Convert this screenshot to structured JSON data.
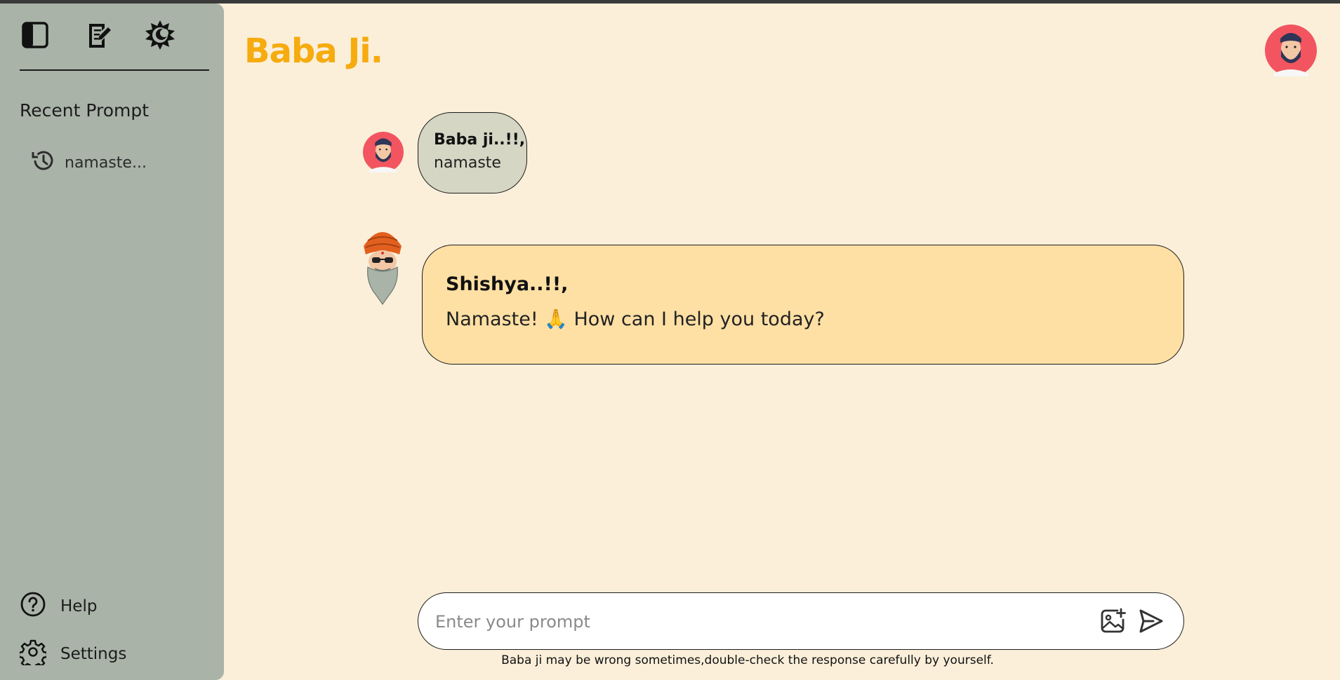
{
  "app": {
    "brand": "Baba Ji."
  },
  "sidebar": {
    "icons": [
      "sidebar-toggle-icon",
      "new-chat-icon",
      "theme-toggle-icon"
    ],
    "recent_title": "Recent Prompt",
    "recent_items": [
      {
        "label": "namaste...",
        "icon": "history-icon"
      }
    ],
    "help_label": "Help",
    "settings_label": "Settings"
  },
  "chat": {
    "messages": [
      {
        "role": "user",
        "sender": "Baba ji..!!,",
        "text": "namaste"
      },
      {
        "role": "bot",
        "sender": "Shishya..!!,",
        "text": "Namaste! 🙏 How can I help you today?"
      }
    ]
  },
  "input": {
    "placeholder": "Enter your prompt",
    "value": ""
  },
  "footer": {
    "disclaimer": "Baba ji may be wrong sometimes,double-check the response carefully by yourself."
  },
  "colors": {
    "background": "#fbefda",
    "sidebar": "#a9b3a8",
    "brand": "#f6ab0e",
    "user_bubble": "#d5d6c3",
    "bot_bubble": "#ffe0a4"
  }
}
